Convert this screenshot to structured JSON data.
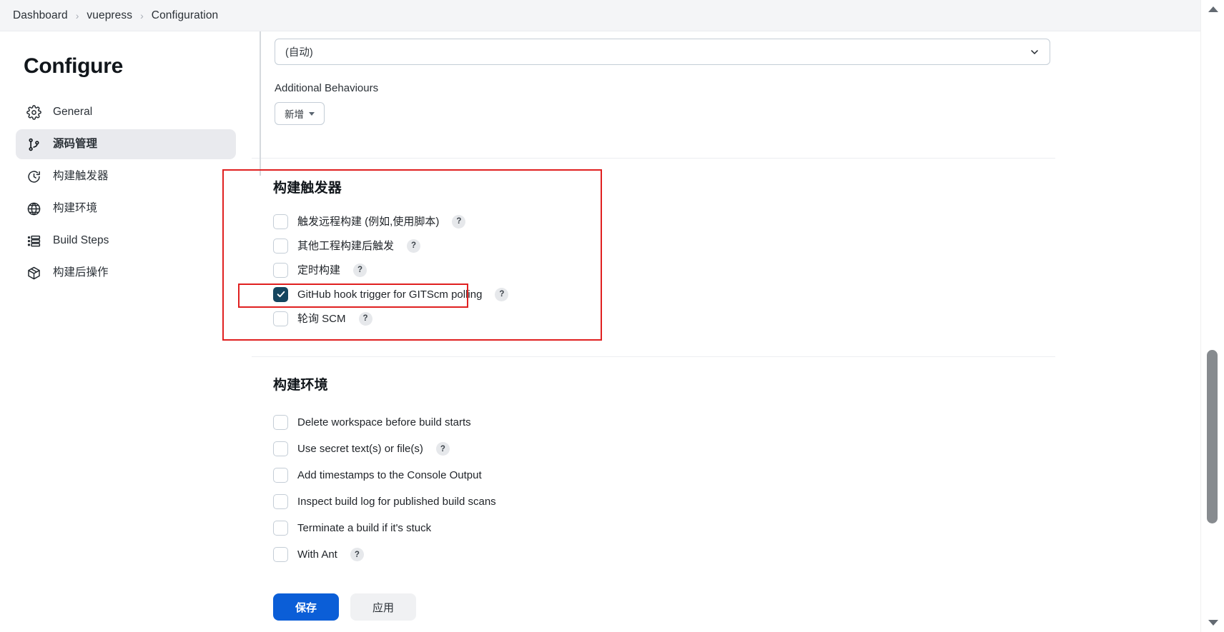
{
  "breadcrumb": {
    "items": [
      "Dashboard",
      "vuepress",
      "Configuration"
    ],
    "separator": "›"
  },
  "sidebar": {
    "title": "Configure",
    "items": [
      {
        "label": "General",
        "icon": "gear-icon",
        "active": false
      },
      {
        "label": "源码管理",
        "icon": "git-branch-icon",
        "active": true
      },
      {
        "label": "构建触发器",
        "icon": "clock-icon",
        "active": false
      },
      {
        "label": "构建环境",
        "icon": "globe-icon",
        "active": false
      },
      {
        "label": "Build Steps",
        "icon": "list-icon",
        "active": false
      },
      {
        "label": "构建后操作",
        "icon": "package-icon",
        "active": false
      }
    ]
  },
  "scm_section": {
    "select_value": "(自动)",
    "additional_behaviours_label": "Additional Behaviours",
    "add_button_label": "新增"
  },
  "triggers_section": {
    "title": "构建触发器",
    "items": [
      {
        "label": "触发远程构建 (例如,使用脚本)",
        "checked": false,
        "help": "?"
      },
      {
        "label": "其他工程构建后触发",
        "checked": false,
        "help": "?"
      },
      {
        "label": "定时构建",
        "checked": false,
        "help": "?"
      },
      {
        "label": "GitHub hook trigger for GITScm polling",
        "checked": true,
        "help": "?"
      },
      {
        "label": "轮询 SCM",
        "checked": false,
        "help": "?"
      }
    ]
  },
  "environment_section": {
    "title": "构建环境",
    "items": [
      {
        "label": "Delete workspace before build starts",
        "checked": false,
        "help": null
      },
      {
        "label": "Use secret text(s) or file(s)",
        "checked": false,
        "help": "?"
      },
      {
        "label": "Add timestamps to the Console Output",
        "checked": false,
        "help": null
      },
      {
        "label": "Inspect build log for published build scans",
        "checked": false,
        "help": null
      },
      {
        "label": "Terminate a build if it's stuck",
        "checked": false,
        "help": null
      },
      {
        "label": "With Ant",
        "checked": false,
        "help": "?"
      }
    ]
  },
  "footer": {
    "save_label": "保存",
    "apply_label": "应用"
  },
  "colors": {
    "accent_blue": "#0b5ed7",
    "checked_checkbox": "#14455f",
    "annotation_red": "#e02020",
    "sidebar_active_bg": "#e9eaee"
  }
}
